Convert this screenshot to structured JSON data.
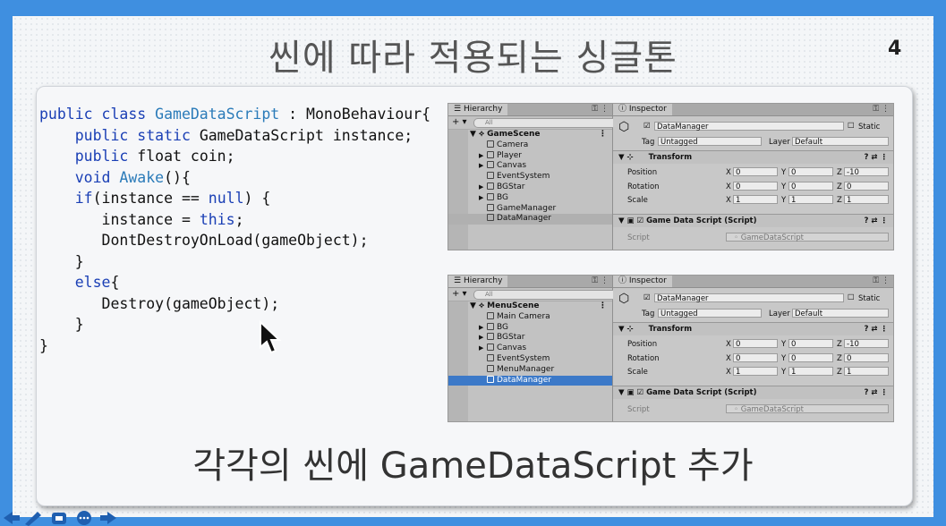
{
  "slide": {
    "title": "씬에 따라 적용되는 싱글톤",
    "page_number": "4",
    "subtitle": "각각의 씬에 GameDataScript 추가"
  },
  "code_lines": [
    [
      {
        "t": "public class ",
        "c": "kw"
      },
      {
        "t": "GameDataScript",
        "c": "ty"
      },
      {
        "t": " : MonoBehaviour{",
        "c": ""
      }
    ],
    [
      {
        "t": "    public static ",
        "c": "kw"
      },
      {
        "t": "GameDataScript instance;",
        "c": ""
      }
    ],
    [
      {
        "t": "    public ",
        "c": "kw"
      },
      {
        "t": "float coin;",
        "c": ""
      }
    ],
    [
      {
        "t": "    void ",
        "c": "kw"
      },
      {
        "t": "Awake",
        "c": "ty"
      },
      {
        "t": "(){",
        "c": ""
      }
    ],
    [
      {
        "t": "    ",
        "c": ""
      },
      {
        "t": "if",
        "c": "kw"
      },
      {
        "t": "(instance == ",
        "c": ""
      },
      {
        "t": "null",
        "c": "kw"
      },
      {
        "t": ") {",
        "c": ""
      }
    ],
    [
      {
        "t": "       instance = ",
        "c": ""
      },
      {
        "t": "this",
        "c": "kw"
      },
      {
        "t": ";",
        "c": ""
      }
    ],
    [
      {
        "t": "       DontDestroyOnLoad(gameObject);",
        "c": ""
      }
    ],
    [
      {
        "t": "    }",
        "c": ""
      }
    ],
    [
      {
        "t": "    ",
        "c": ""
      },
      {
        "t": "else",
        "c": "kw"
      },
      {
        "t": "{",
        "c": ""
      }
    ],
    [
      {
        "t": "       Destroy(gameObject);",
        "c": ""
      }
    ],
    [
      {
        "t": "    }",
        "c": ""
      }
    ],
    [
      {
        "t": "}",
        "c": ""
      }
    ]
  ],
  "unity_panels": [
    {
      "hierarchy_tab": "Hierarchy",
      "search_placeholder": "All",
      "scene": "GameScene",
      "items": [
        {
          "label": "Camera",
          "arrow": ""
        },
        {
          "label": "Player",
          "arrow": "▶"
        },
        {
          "label": "Canvas",
          "arrow": "▶"
        },
        {
          "label": "EventSystem",
          "arrow": ""
        },
        {
          "label": "BGStar",
          "arrow": "▶"
        },
        {
          "label": "BG",
          "arrow": "▶"
        },
        {
          "label": "GameManager",
          "arrow": ""
        },
        {
          "label": "DataManager",
          "arrow": "",
          "selected": "grey"
        }
      ],
      "inspector": {
        "tab": "Inspector",
        "object_name": "DataManager",
        "static_label": "Static",
        "tag_label": "Tag",
        "tag_value": "Untagged",
        "layer_label": "Layer",
        "layer_value": "Default",
        "transform_label": "Transform",
        "position_label": "Position",
        "rotation_label": "Rotation",
        "scale_label": "Scale",
        "position": [
          "0",
          "0",
          "-10"
        ],
        "rotation": [
          "0",
          "0",
          "0"
        ],
        "scale": [
          "1",
          "1",
          "1"
        ],
        "component_label": "Game Data Script (Script)",
        "script_label": "Script",
        "script_value": "GameDataScript"
      }
    },
    {
      "hierarchy_tab": "Hierarchy",
      "search_placeholder": "All",
      "scene": "MenuScene",
      "items": [
        {
          "label": "Main Camera",
          "arrow": ""
        },
        {
          "label": "BG",
          "arrow": "▶"
        },
        {
          "label": "BGStar",
          "arrow": "▶"
        },
        {
          "label": "Canvas",
          "arrow": "▶"
        },
        {
          "label": "EventSystem",
          "arrow": ""
        },
        {
          "label": "MenuManager",
          "arrow": ""
        },
        {
          "label": "DataManager",
          "arrow": "",
          "selected": "blue"
        }
      ],
      "inspector": {
        "tab": "Inspector",
        "object_name": "DataManager",
        "static_label": "Static",
        "tag_label": "Tag",
        "tag_value": "Untagged",
        "layer_label": "Layer",
        "layer_value": "Default",
        "transform_label": "Transform",
        "position_label": "Position",
        "rotation_label": "Rotation",
        "scale_label": "Scale",
        "position": [
          "0",
          "0",
          "-10"
        ],
        "rotation": [
          "0",
          "0",
          "0"
        ],
        "scale": [
          "1",
          "1",
          "1"
        ],
        "component_label": "Game Data Script (Script)",
        "script_label": "Script",
        "script_value": "GameDataScript"
      }
    }
  ],
  "axis_labels": [
    "X",
    "Y",
    "Z"
  ],
  "colors": {
    "frame": "#3f8fe0",
    "keyword": "#1a3fb5",
    "type": "#2b7bb9",
    "selection": "#3c79c8"
  }
}
